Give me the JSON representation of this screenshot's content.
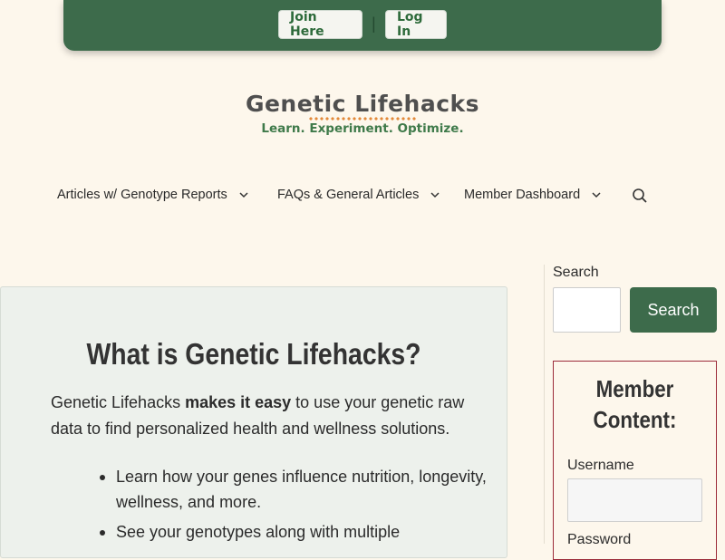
{
  "header": {
    "join_label": "Join Here",
    "separator": "|",
    "login_label": "Log In"
  },
  "logo": {
    "title": "Genetic Lifehacks",
    "tagline": "Learn. Experiment. Optimize."
  },
  "nav": {
    "items": [
      {
        "label": "Articles w/ Genotype Reports",
        "icon": "chevron-down-icon"
      },
      {
        "label": "FAQs & General Articles",
        "icon": "chevron-down-icon"
      },
      {
        "label": "Member Dashboard",
        "icon": "chevron-down-icon"
      }
    ],
    "search_icon": "search-icon"
  },
  "main": {
    "title": "What is Genetic Lifehacks?",
    "intro_start": "Genetic Lifehacks ",
    "intro_bold": "makes it easy",
    "intro_end": " to use your genetic raw data to find personalized health and wellness solutions.",
    "bullets": [
      "Learn how your genes influence nutrition, longevity, wellness, and more.",
      "See your genotypes along with multiple"
    ]
  },
  "sidebar": {
    "search_label": "Search",
    "search_button": "Search",
    "member_title": "Member Content:",
    "username_label": "Username",
    "password_label": "Password"
  },
  "colors": {
    "brand_green": "#3d6b4b",
    "page_background": "#fdf7ec",
    "accent_orange": "#e2893a",
    "member_border": "#9c2b3a"
  }
}
